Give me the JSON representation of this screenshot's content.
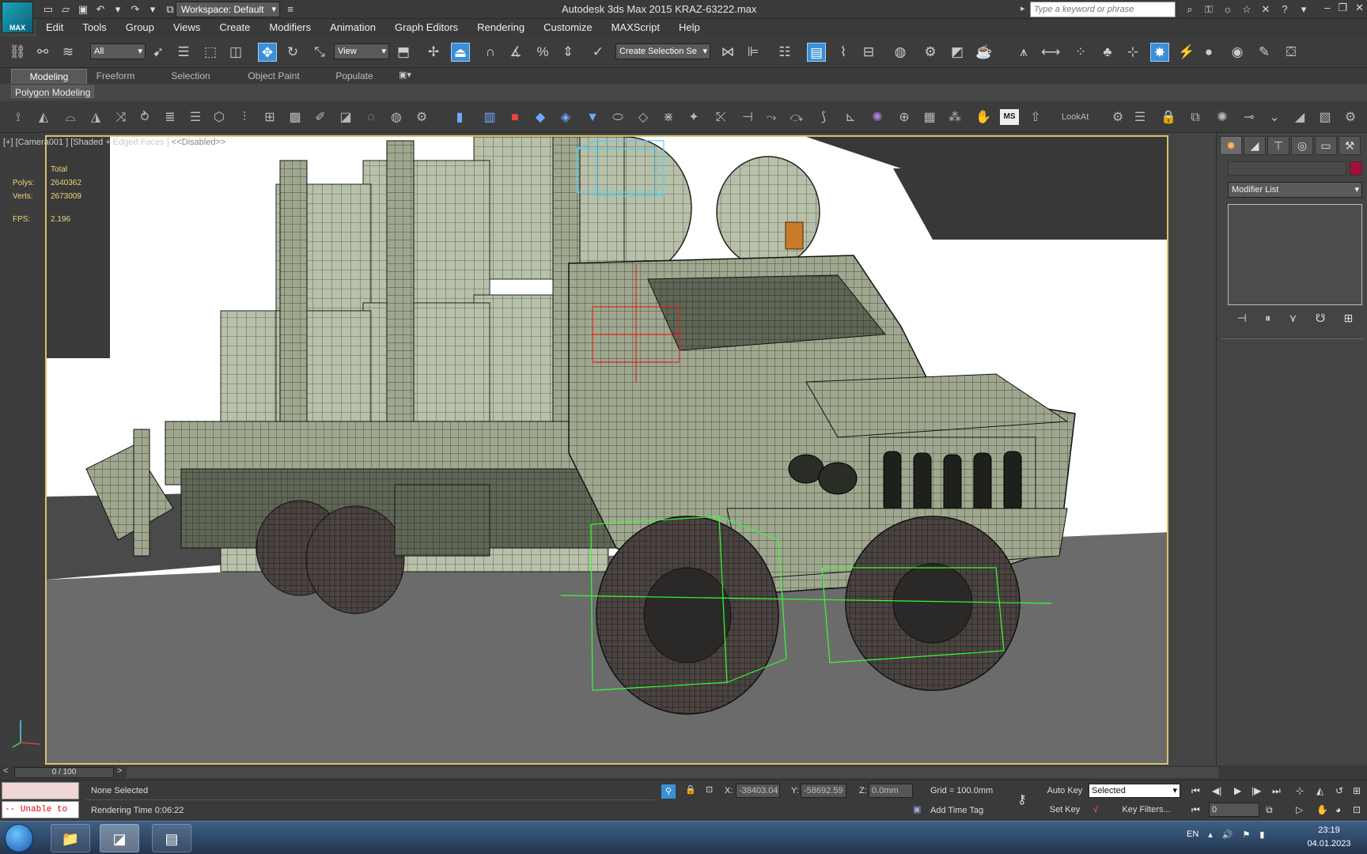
{
  "app": {
    "logo": "MAX",
    "title": "Autodesk 3ds Max  2015     KRAZ-63222.max",
    "workspace": "Workspace: Default",
    "search_placeholder": "Type a keyword or phrase"
  },
  "menu": [
    "Edit",
    "Tools",
    "Group",
    "Views",
    "Create",
    "Modifiers",
    "Animation",
    "Graph Editors",
    "Rendering",
    "Customize",
    "MAXScript",
    "Help"
  ],
  "toolbar": {
    "selection_filter": "All",
    "ref_coord": "View",
    "named_selection": "Create Selection Se"
  },
  "ribbon": {
    "tabs": [
      "Modeling",
      "Freeform",
      "Selection",
      "Object Paint",
      "Populate"
    ],
    "active_tab": "Modeling",
    "panel_label": "Polygon Modeling",
    "lookat_label": "LookAt"
  },
  "viewport": {
    "label_main": "[+] [Camera001 ] [Shaded + Edged Faces ]",
    "label_disabled": "<<Disabled>>",
    "stats": {
      "total_label": "Total",
      "polys_label": "Polys:",
      "polys": "2640362",
      "verts_label": "Verts:",
      "verts": "2673009",
      "fps_label": "FPS:",
      "fps": "2.196"
    }
  },
  "command_panel": {
    "modifier_list": "Modifier List",
    "object_color": "#a0103a"
  },
  "timeline": {
    "frame": "0 / 100"
  },
  "status": {
    "maxscript_error": "-- Unable to",
    "selection": "None Selected",
    "rendering_time": "Rendering Time  0:06:22",
    "x_label": "X:",
    "x": "-38403.04",
    "y_label": "Y:",
    "y": "-58692.59",
    "z_label": "Z:",
    "z": "0.0mm",
    "grid": "Grid = 100.0mm",
    "add_time_tag": "Add Time Tag",
    "auto_key": "Auto Key",
    "set_key": "Set Key",
    "key_mode": "Selected",
    "key_filters": "Key Filters...",
    "current_frame": "0"
  },
  "taskbar": {
    "language": "EN",
    "time": "23:19",
    "date": "04.01.2023"
  }
}
